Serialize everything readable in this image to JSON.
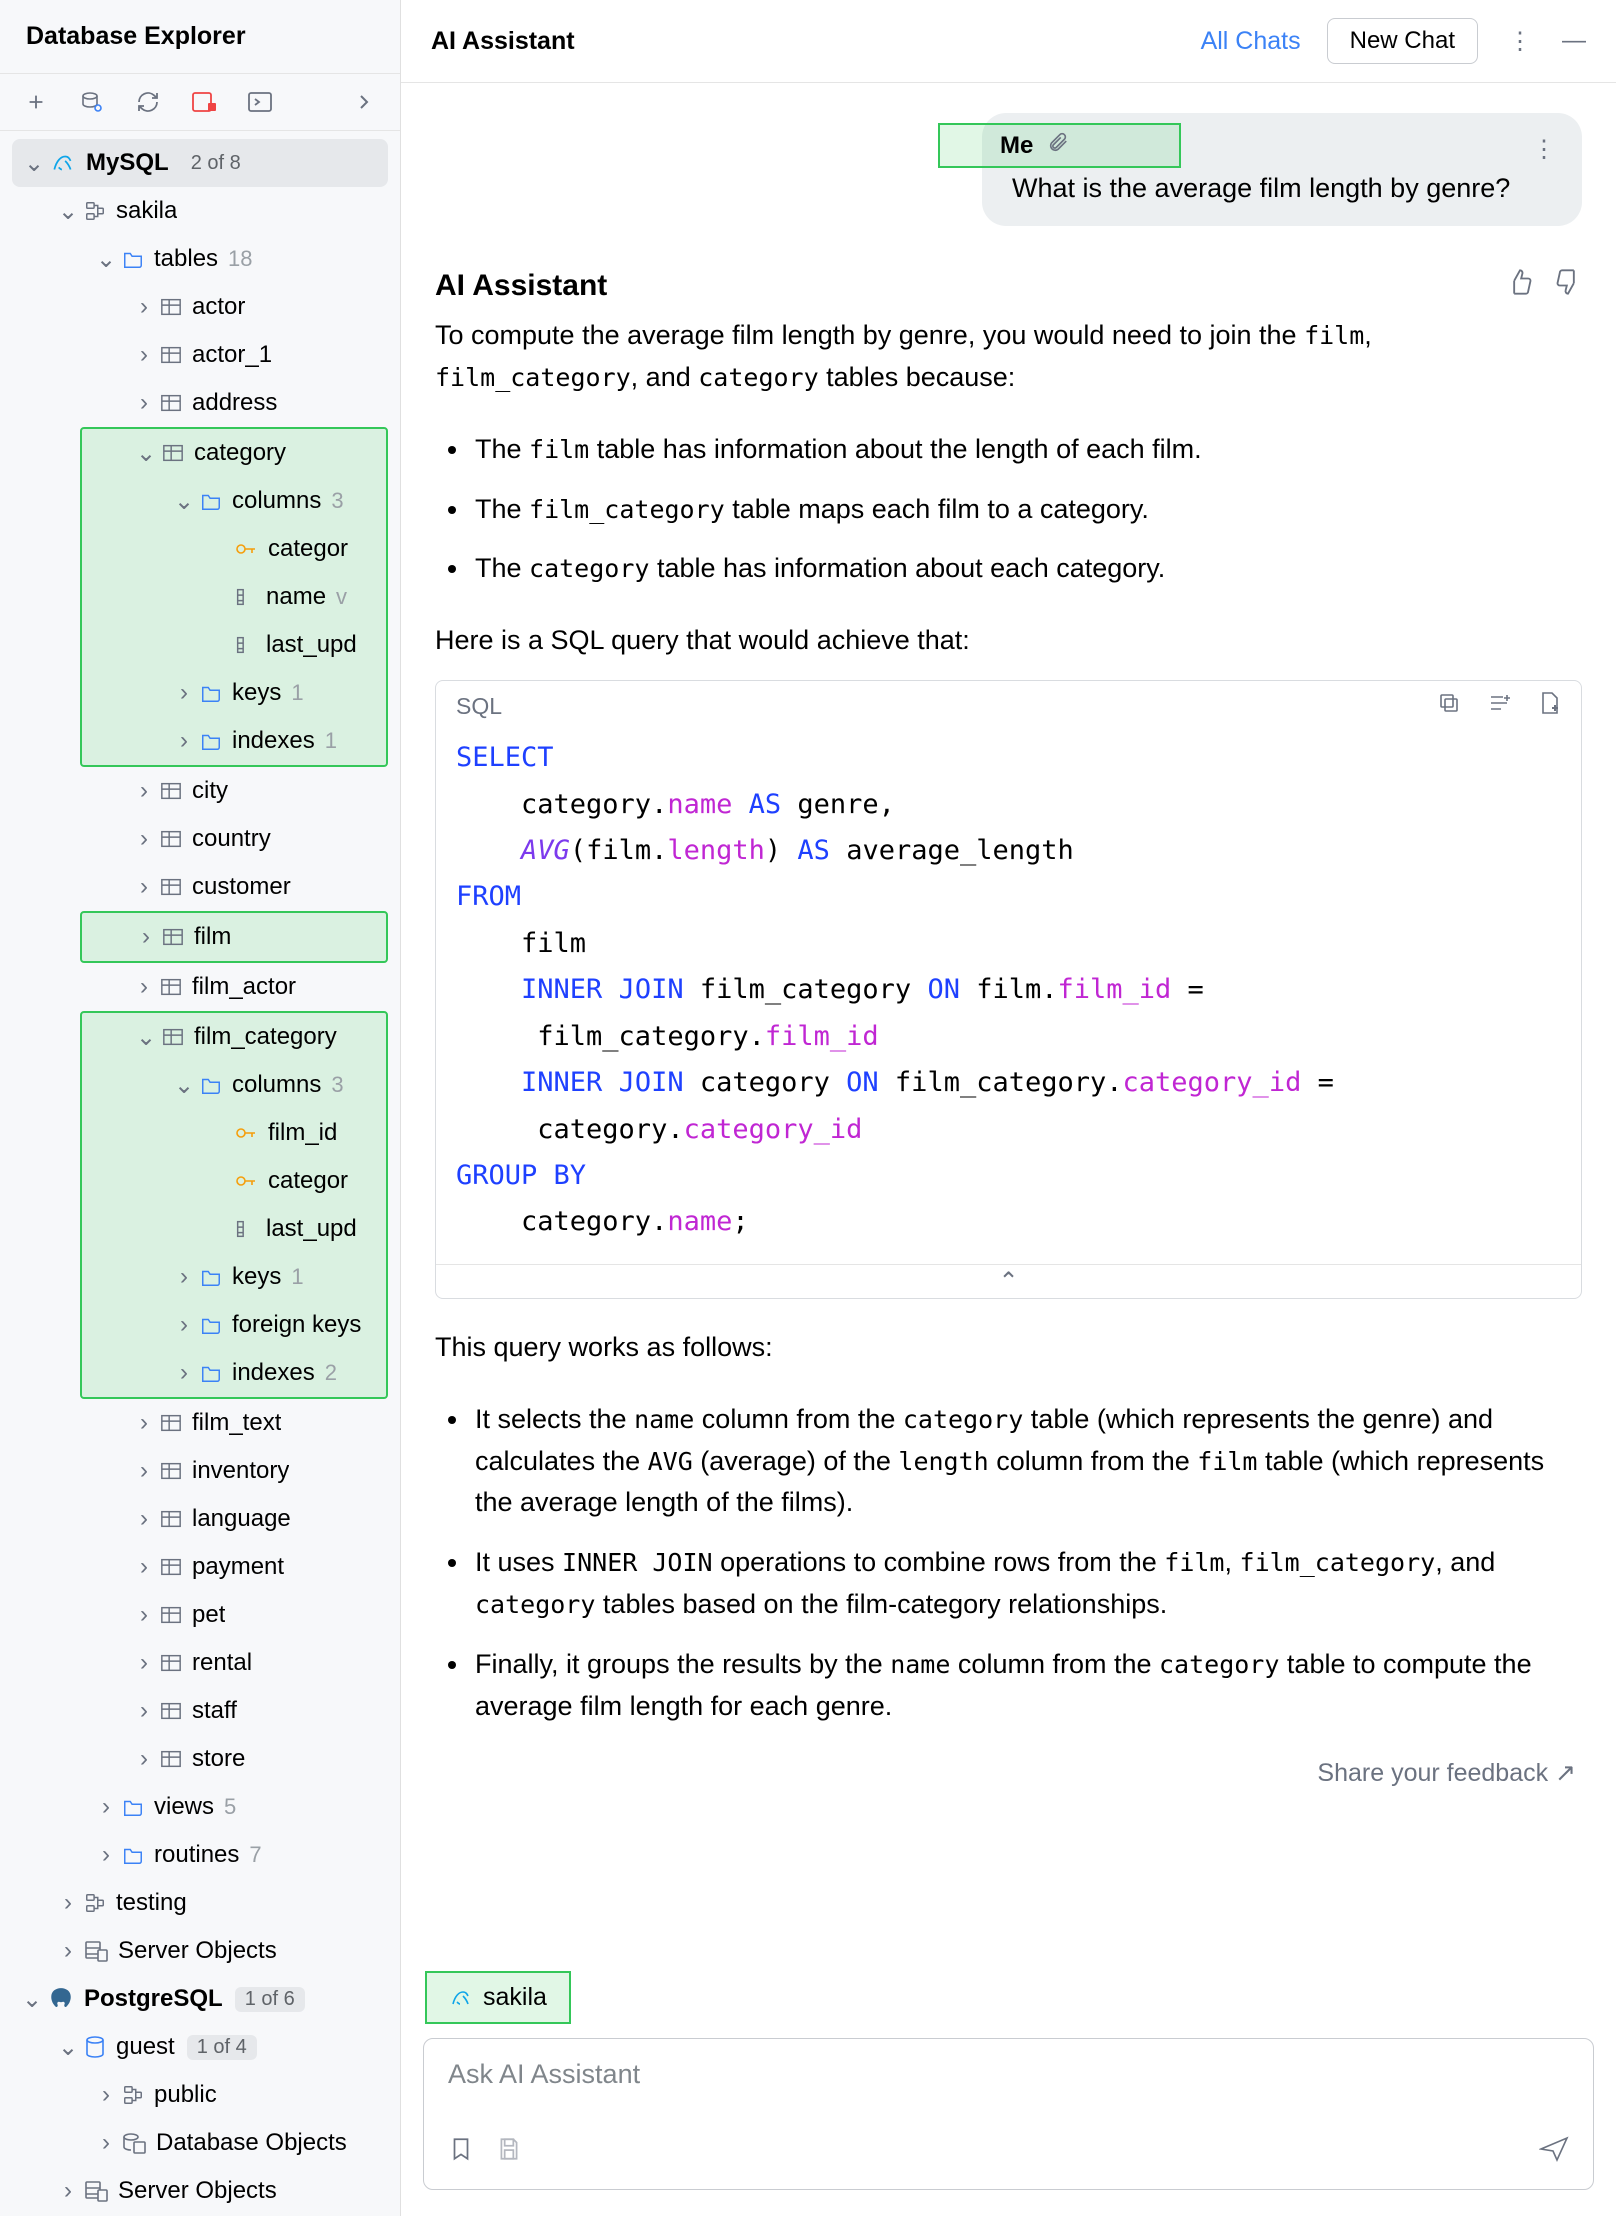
{
  "sidebar": {
    "title": "Database Explorer",
    "datasources": [
      {
        "name": "MySQL",
        "badge": "2 of 8",
        "icon": "mysql"
      },
      {
        "name": "PostgreSQL",
        "badge": "1 of 6",
        "icon": "postgres"
      }
    ],
    "mysql": {
      "schema": "sakila",
      "tables_label": "tables",
      "tables_count": "18",
      "tables": [
        "actor",
        "actor_1",
        "address",
        "category",
        "city",
        "country",
        "customer",
        "film",
        "film_actor",
        "film_category",
        "film_text",
        "inventory",
        "language",
        "payment",
        "pet",
        "rental",
        "staff",
        "store"
      ],
      "category": {
        "columns_label": "columns",
        "columns_count": "3",
        "columns": [
          "category_id",
          "name",
          "last_update"
        ],
        "keys_label": "keys",
        "keys_count": "1",
        "indexes_label": "indexes",
        "indexes_count": "1"
      },
      "film_category": {
        "columns_label": "columns",
        "columns_count": "3",
        "columns": [
          "film_id",
          "category_id",
          "last_update"
        ],
        "keys_label": "keys",
        "keys_count": "1",
        "fk_label": "foreign keys",
        "indexes_label": "indexes",
        "indexes_count": "2"
      },
      "views_label": "views",
      "views_count": "5",
      "routines_label": "routines",
      "routines_count": "7",
      "testing_schema": "testing",
      "server_objects": "Server Objects"
    },
    "postgres": {
      "db": "guest",
      "db_badge": "1 of 4",
      "public": "public",
      "dbobjects": "Database Objects",
      "server_objects": "Server Objects"
    }
  },
  "chat": {
    "title": "AI Assistant",
    "all_chats": "All Chats",
    "new_chat": "New Chat",
    "user": {
      "name": "Me",
      "message": "What is the average film length by genre?"
    },
    "assistant": {
      "name": "AI Assistant",
      "intro_pre": "To compute the average film length by genre, you would need to join the ",
      "intro_tables": [
        "film",
        "film_category",
        "category"
      ],
      "intro_post": " tables because:",
      "bullets1": [
        {
          "pre": "The ",
          "code": "film",
          "post": " table has information about the length of each film."
        },
        {
          "pre": "The ",
          "code": "film_category",
          "post": " table maps each film to a category."
        },
        {
          "pre": "The ",
          "code": "category",
          "post": " table has information about each category."
        }
      ],
      "lead2": "Here is a SQL query that would achieve that:",
      "code_lang": "SQL",
      "explain_lead": "This query works as follows:",
      "bullets2": [
        "It selects the name column from the category table (which represents the genre) and calculates the AVG (average) of the length column from the film table (which represents the average length of the films).",
        "It uses INNER JOIN operations to combine rows from the film, film_category, and category tables based on the film-category relationships.",
        "Finally, it groups the results by the name column from the category table to compute the average film length for each genre."
      ],
      "sql": {
        "lines": [
          "SELECT",
          "    category.name AS genre,",
          "    AVG(film.length) AS average_length",
          "FROM",
          "    film",
          "    INNER JOIN film_category ON film.film_id =",
          "     film_category.film_id",
          "    INNER JOIN category ON film_category.category_id =",
          "     category.category_id",
          "GROUP BY",
          "    category.name;"
        ]
      }
    },
    "feedback": "Share your feedback ↗",
    "context_chip": "sakila",
    "input_placeholder": "Ask AI Assistant"
  }
}
